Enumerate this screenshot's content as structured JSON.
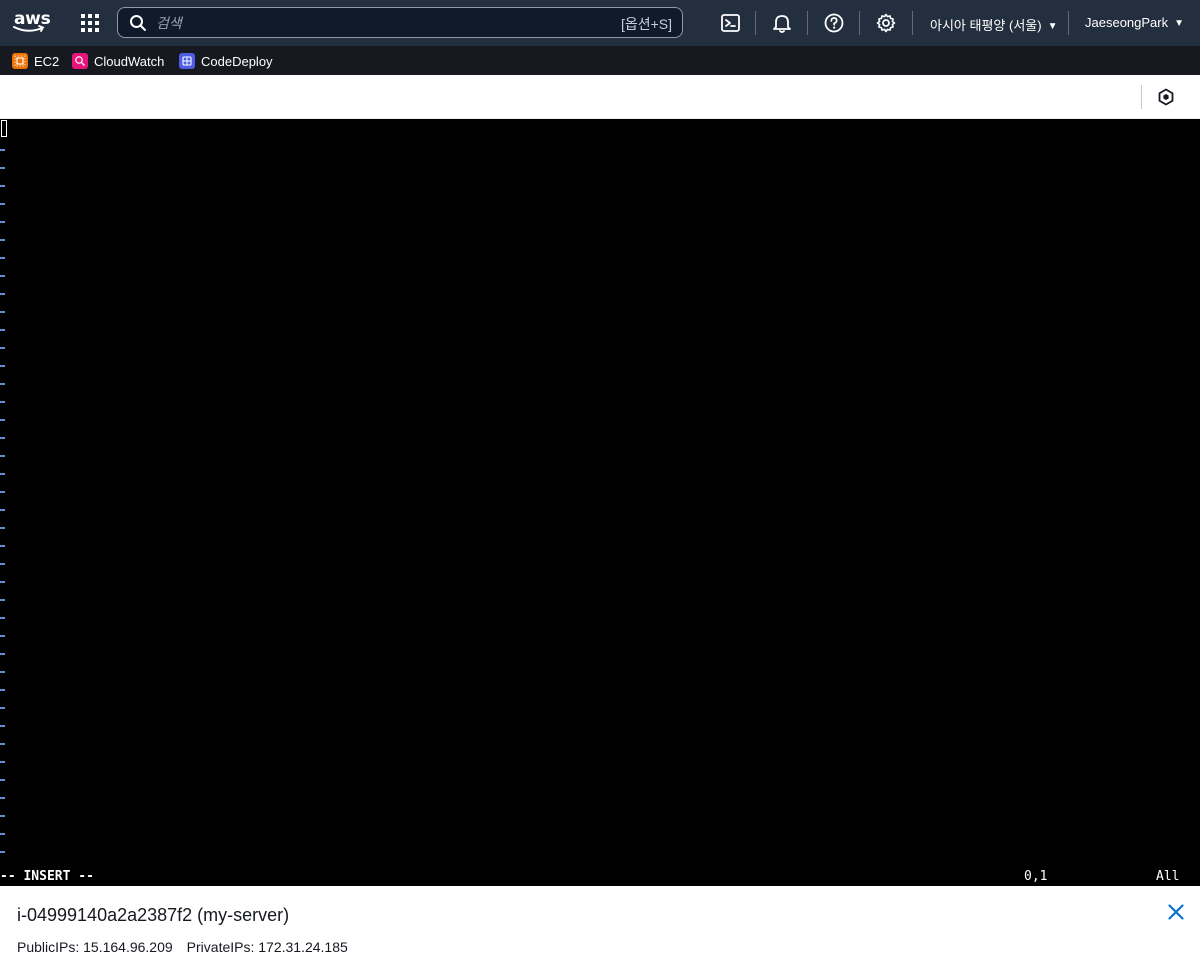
{
  "nav": {
    "logo": "aws",
    "search_placeholder": "검색",
    "search_shortcut": "[옵션+S]",
    "region": "아시아 태평양 (서울)",
    "user": "JaeseongPark",
    "icons": [
      "apps-grid-icon",
      "search-icon",
      "cloudshell-icon",
      "bell-icon",
      "help-icon",
      "gear-icon"
    ]
  },
  "favorites": [
    {
      "label": "EC2",
      "icon": "ec2-icon",
      "color": "#ed7100"
    },
    {
      "label": "CloudWatch",
      "icon": "cloudwatch-icon",
      "color": "#e7157b"
    },
    {
      "label": "CodeDeploy",
      "icon": "codedeploy-icon",
      "color": "#4d5ee5"
    }
  ],
  "terminal": {
    "mode_line": "-- INSERT --",
    "cursor_pos": "0,1",
    "scroll_pos": "All",
    "tilde_color": "#5f8fd6"
  },
  "instance": {
    "title": "i-04999140a2a2387f2 (my-server)",
    "public_ips": "PublicIPs: 15.164.96.209",
    "private_ips": "PrivateIPs: 172.31.24.185"
  }
}
